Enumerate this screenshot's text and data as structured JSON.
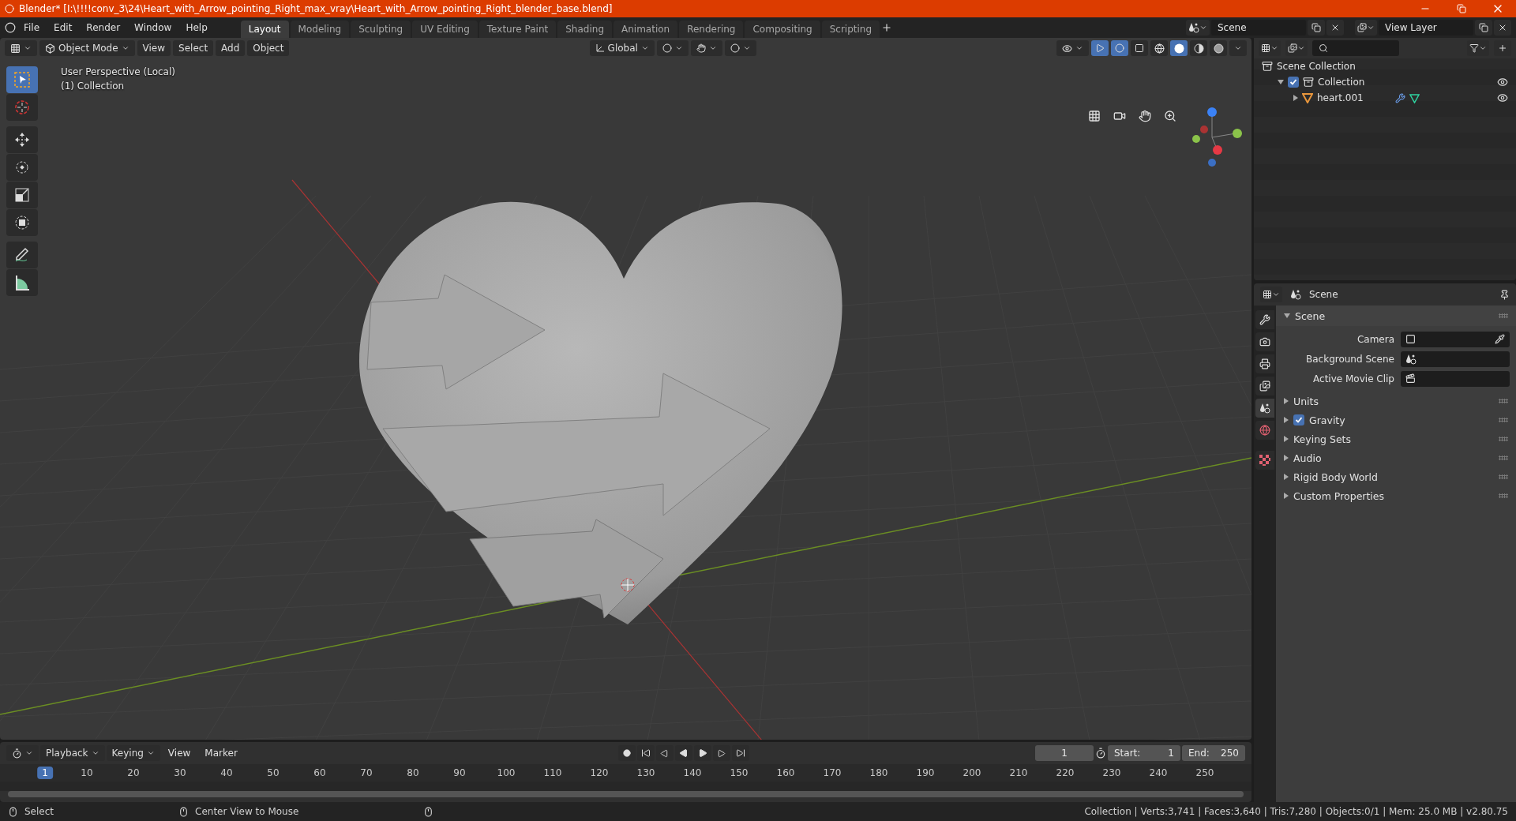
{
  "window": {
    "title": "Blender* [I:\\!!!!conv_3\\24\\Heart_with_Arrow_pointing_Right_max_vray\\Heart_with_Arrow_pointing_Right_blender_base.blend]"
  },
  "menus": [
    "File",
    "Edit",
    "Render",
    "Window",
    "Help"
  ],
  "workspaces": [
    {
      "label": "Layout",
      "selected": true
    },
    {
      "label": "Modeling",
      "selected": false
    },
    {
      "label": "Sculpting",
      "selected": false
    },
    {
      "label": "UV Editing",
      "selected": false
    },
    {
      "label": "Texture Paint",
      "selected": false
    },
    {
      "label": "Shading",
      "selected": false
    },
    {
      "label": "Animation",
      "selected": false
    },
    {
      "label": "Rendering",
      "selected": false
    },
    {
      "label": "Compositing",
      "selected": false
    },
    {
      "label": "Scripting",
      "selected": false
    }
  ],
  "scene": "Scene",
  "view_layer": "View Layer",
  "viewport": {
    "mode": "Object Mode",
    "menus": [
      "View",
      "Select",
      "Add",
      "Object"
    ],
    "orientation": "Global",
    "info": [
      "User Perspective (Local)",
      "(1) Collection"
    ],
    "tools": [
      {
        "kind": "select",
        "selected": true
      },
      {
        "kind": "cursor",
        "selected": false
      },
      {
        "kind": "move",
        "selected": false
      },
      {
        "kind": "rotate",
        "selected": false
      },
      {
        "kind": "scale",
        "selected": false
      },
      {
        "kind": "transform",
        "selected": false
      },
      {
        "kind": "annotate",
        "selected": false
      },
      {
        "kind": "measure",
        "selected": false
      }
    ],
    "shading": [
      {
        "kind": "wireframe",
        "selected": false
      },
      {
        "kind": "solid",
        "selected": true
      },
      {
        "kind": "material",
        "selected": false
      },
      {
        "kind": "rendered",
        "selected": false
      }
    ]
  },
  "outliner": {
    "root": "Scene Collection",
    "children": [
      {
        "label": "Collection",
        "kind": "collection",
        "checked": true,
        "expanded": true,
        "children": [
          {
            "label": "heart.001",
            "kind": "mesh",
            "expanded": false
          }
        ]
      }
    ]
  },
  "properties": {
    "context": "Scene",
    "tabs": [
      {
        "kind": "tool",
        "selected": false
      },
      {
        "kind": "render",
        "selected": false
      },
      {
        "kind": "output",
        "selected": false
      },
      {
        "kind": "view_layer",
        "selected": false
      },
      {
        "kind": "scene",
        "selected": true
      },
      {
        "kind": "world",
        "selected": false
      },
      {
        "kind": "texture",
        "selected": false
      }
    ],
    "section": {
      "label": "Scene",
      "expanded": true
    },
    "fields": [
      {
        "label": "Camera",
        "kind": "camera"
      },
      {
        "label": "Background Scene",
        "kind": "scene"
      },
      {
        "label": "Active Movie Clip",
        "kind": "clip"
      }
    ],
    "panels": [
      {
        "label": "Units",
        "kind": "plain"
      },
      {
        "label": "Gravity",
        "kind": "checkbox",
        "checked": true
      },
      {
        "label": "Keying Sets",
        "kind": "plain"
      },
      {
        "label": "Audio",
        "kind": "plain"
      },
      {
        "label": "Rigid Body World",
        "kind": "plain"
      },
      {
        "label": "Custom Properties",
        "kind": "plain"
      }
    ]
  },
  "timeline": {
    "menus": [
      {
        "label": "Playback",
        "kind": "dropdown"
      },
      {
        "label": "Keying",
        "kind": "dropdown"
      },
      {
        "label": "View",
        "kind": "plain"
      },
      {
        "label": "Marker",
        "kind": "plain"
      }
    ],
    "current_frame": "1",
    "start_label": "Start:",
    "start": "1",
    "end_label": "End:",
    "end": "250",
    "ruler": [
      "1",
      "10",
      "20",
      "30",
      "40",
      "50",
      "60",
      "70",
      "80",
      "90",
      "100",
      "110",
      "120",
      "130",
      "140",
      "150",
      "160",
      "170",
      "180",
      "190",
      "200",
      "210",
      "220",
      "230",
      "240",
      "250"
    ]
  },
  "status_bar": {
    "hints": [
      "Select",
      "Center View to Mouse"
    ],
    "stats": "Collection | Verts:3,741 | Faces:3,640 | Tris:7,280 | Objects:0/1 | Mem: 25.0 MB | v2.80.75"
  }
}
